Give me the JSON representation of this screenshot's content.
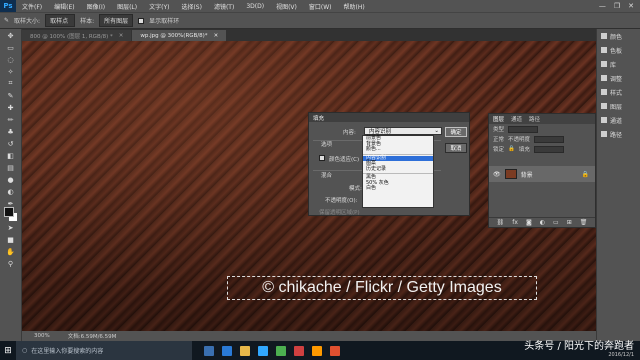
{
  "menubar": {
    "logo": "Ps",
    "items": [
      "文件(F)",
      "编辑(E)",
      "图像(I)",
      "图层(L)",
      "文字(Y)",
      "选择(S)",
      "滤镜(T)",
      "3D(D)",
      "视图(V)",
      "窗口(W)",
      "帮助(H)"
    ],
    "window_controls": [
      "—",
      "❐",
      "✕"
    ]
  },
  "optionsbar": {
    "sample_size_label": "取样大小:",
    "sample_size_value": "取样点",
    "sample_label": "样本:",
    "sample_value": "所有图层",
    "show_ring_label": "显示取样环"
  },
  "tabs": [
    {
      "label": "800 @ 100% (图层 1, RGB/8) *",
      "active": false
    },
    {
      "label": "wp.jpg @ 300%(RGB/8)*",
      "active": true
    }
  ],
  "canvas": {
    "watermark": "© chikache / Flickr / Getty Images"
  },
  "statusbar": {
    "zoom": "300%",
    "doc": "文档:6.59M/6.59M"
  },
  "right_strip": {
    "items": [
      "颜色",
      "色板",
      "库",
      "调整",
      "样式",
      "图层",
      "通道",
      "路径"
    ]
  },
  "layers_panel": {
    "tabs": [
      "图层",
      "通道",
      "路径"
    ],
    "kind_label": "类型",
    "mode": "正常",
    "opacity_label": "不透明度",
    "lock_label": "锁定",
    "fill_label": "填充",
    "layer_name": "背景"
  },
  "fill_dialog": {
    "title": "填充",
    "contents_label": "内容:",
    "contents_value": "内容识别",
    "options_label": "选项",
    "color_adapt_label": "颜色适应(C)",
    "blending_label": "混合",
    "mode_label": "模式:",
    "opacity_label": "不透明度(O):",
    "preserve_label": "保留透明区域(P)",
    "ok_label": "确定",
    "cancel_label": "取消",
    "options_list": [
      "前景色",
      "背景色",
      "颜色...",
      "内容识别",
      "图案",
      "历史记录",
      "黑色",
      "50% 灰色",
      "白色"
    ],
    "selected_index": 3
  },
  "taskbar": {
    "search_placeholder": "在这里输入你要搜索的内容",
    "watermark_text": "头条号 / 阳光下的奔跑者",
    "date": "2016/12/1"
  },
  "colors": {
    "accent": "#2e6fd8",
    "panel": "#535353",
    "workspace": "#282828"
  }
}
